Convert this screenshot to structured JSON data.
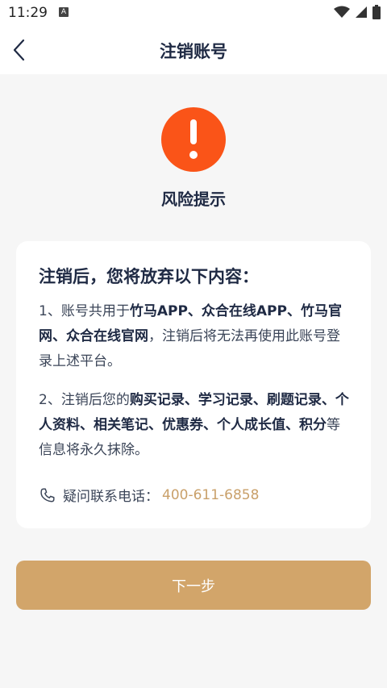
{
  "status_bar": {
    "time": "11:29",
    "notif_letter": "A"
  },
  "header": {
    "title": "注销账号"
  },
  "risk": {
    "title": "风险提示"
  },
  "card": {
    "heading": "注销后，您将放弃以下内容：",
    "item1": {
      "prefix": "1、账号共用于",
      "bold": "竹马APP、众合在线APP、竹马官网、众合在线官网",
      "suffix": "，注销后将无法再使用此账号登录上述平台。"
    },
    "item2": {
      "prefix": "2、注销后您的",
      "bold": "购买记录、学习记录、刷题记录、个人资料、相关笔记、优惠券、个人成长值、积分",
      "suffix": "等信息将永久抹除。"
    },
    "phone_label": "疑问联系电话：",
    "phone_number": "400-611-6858"
  },
  "actions": {
    "next_label": "下一步"
  },
  "colors": {
    "warning": "#fa5418",
    "accent": "#d2a56a",
    "phone": "#c9a06a"
  }
}
